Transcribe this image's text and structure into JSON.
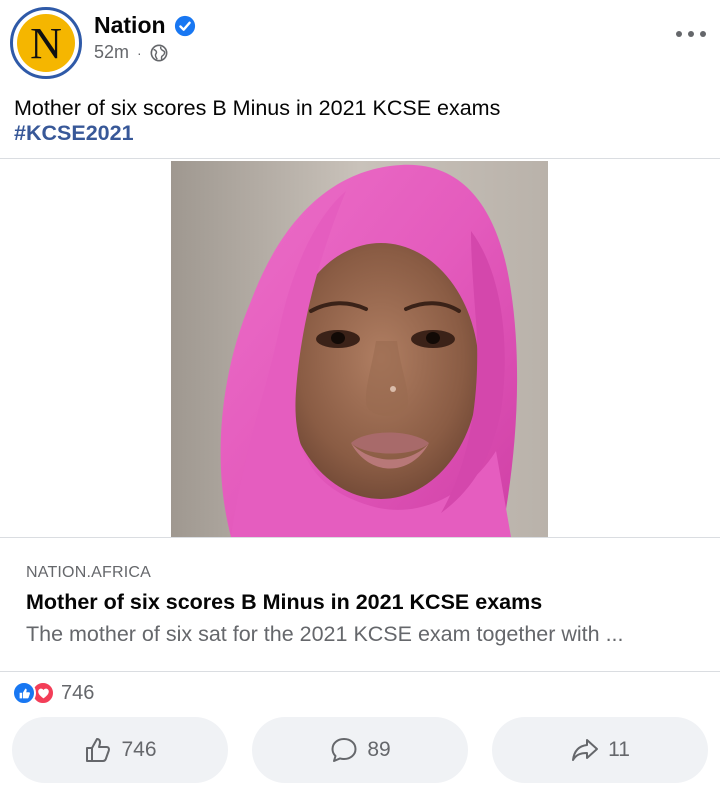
{
  "post": {
    "page_name": "Nation",
    "avatar_letter": "N",
    "time": "52m",
    "separator": "·",
    "text": "Mother of six scores B Minus in 2021 KCSE exams",
    "hashtag": "#KCSE2021"
  },
  "link": {
    "domain": "NATION.AFRICA",
    "title": "Mother of six scores B Minus in 2021 KCSE exams",
    "description": "The mother of six sat for the 2021 KCSE exam together with ..."
  },
  "reactions": {
    "count": "746",
    "types": [
      "like-icon",
      "love-icon"
    ]
  },
  "actions": {
    "like_count": "746",
    "comment_count": "89",
    "share_count": "11"
  },
  "colors": {
    "brand_blue": "#1877f2",
    "hashtag": "#385898",
    "love": "#f33e58",
    "avatar_bg": "#f5b600"
  }
}
